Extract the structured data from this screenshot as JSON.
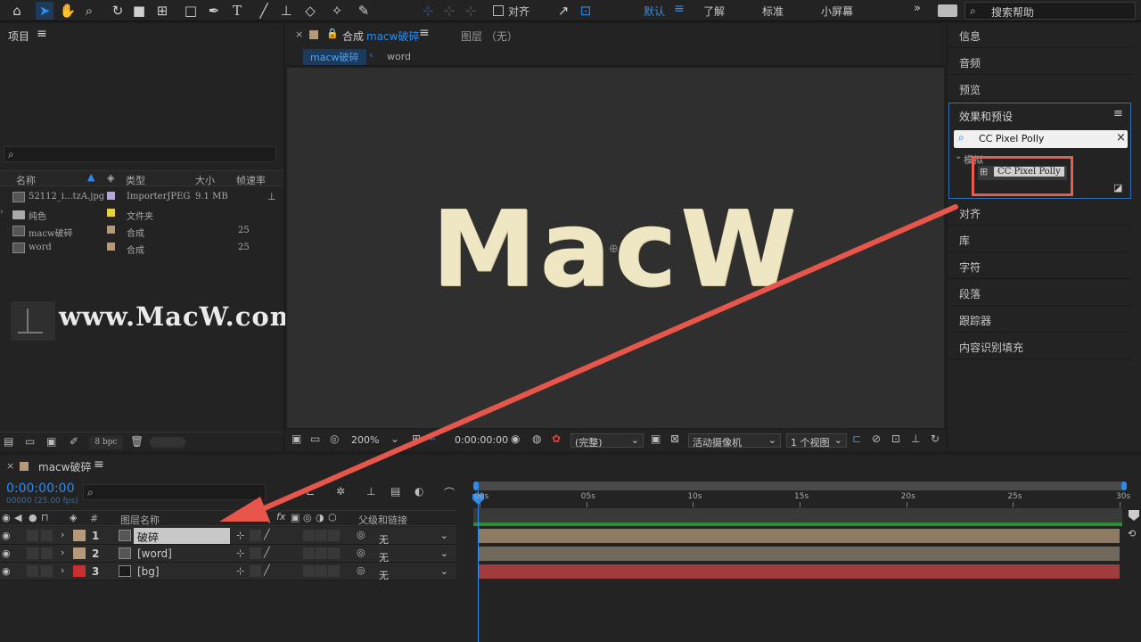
{
  "toolbar": {
    "snap_label": "对齐",
    "workspaces": [
      "默认",
      "了解",
      "标准",
      "小屏幕"
    ],
    "active_workspace": "默认",
    "search_placeholder": "搜索帮助"
  },
  "project_panel": {
    "title": "项目",
    "columns": [
      "名称",
      "类型",
      "大小",
      "帧速率"
    ],
    "items": [
      {
        "name": "52112_i...tzA.jpg",
        "type": "ImporterJPEG",
        "size": "9.1 MB",
        "fps": "",
        "color": "#b4a6d8",
        "icon": "image-icon"
      },
      {
        "name": "纯色",
        "type": "文件夹",
        "size": "",
        "fps": "",
        "color": "#e8d040",
        "icon": "folder-icon"
      },
      {
        "name": "macw破碎",
        "type": "合成",
        "size": "",
        "fps": "25",
        "color": "#b49a7a",
        "icon": "composition-icon"
      },
      {
        "name": "word",
        "type": "合成",
        "size": "",
        "fps": "25",
        "color": "#b49a7a",
        "icon": "composition-icon"
      }
    ],
    "bpc_label": "8 bpc"
  },
  "watermark": {
    "text": "www.MacW.com"
  },
  "comp_panel": {
    "tab_label": "合成",
    "comp_name": "macw破碎",
    "layer_tab": "图层 （无）",
    "breadcrumb": [
      "macw破碎",
      "word"
    ],
    "canvas_text": "MacW",
    "zoom": "200%",
    "timecode": "0:00:00:00",
    "resolution": "(完整)",
    "camera": "活动摄像机",
    "views": "1 个视图"
  },
  "right_panel": {
    "items_top": [
      "信息",
      "音频",
      "预览"
    ],
    "effects_title": "效果和预设",
    "effects_search": "CC Pixel Polly",
    "effects_category": "模拟",
    "effects_result": "CC Pixel Polly",
    "items_bottom": [
      "对齐",
      "库",
      "字符",
      "段落",
      "跟踪器",
      "内容识别填充"
    ]
  },
  "timeline": {
    "comp_name": "macw破碎",
    "timecode": "0:00:00:00",
    "frame_info": "00000 (25.00 fps)",
    "col_layer_name": "图层名称",
    "col_number": "#",
    "col_parent": "父级和链接",
    "ruler": [
      "00s",
      "05s",
      "10s",
      "15s",
      "20s",
      "25s",
      "30s"
    ],
    "layers": [
      {
        "num": "1",
        "name": "破碎",
        "color": "#b49a7a",
        "parent": "无",
        "bar_color": "#8c7b62",
        "selected": true
      },
      {
        "num": "2",
        "name": "[word]",
        "color": "#b49a7a",
        "parent": "无",
        "bar_color": "#716a5c",
        "selected": false
      },
      {
        "num": "3",
        "name": "[bg]",
        "color": "#c83030",
        "parent": "无",
        "bar_color": "#a03c3c",
        "selected": false
      }
    ]
  },
  "colors": {
    "accent": "#2d8ceb",
    "highlight_box": "#e85c50",
    "arrow": "#e8564b"
  }
}
